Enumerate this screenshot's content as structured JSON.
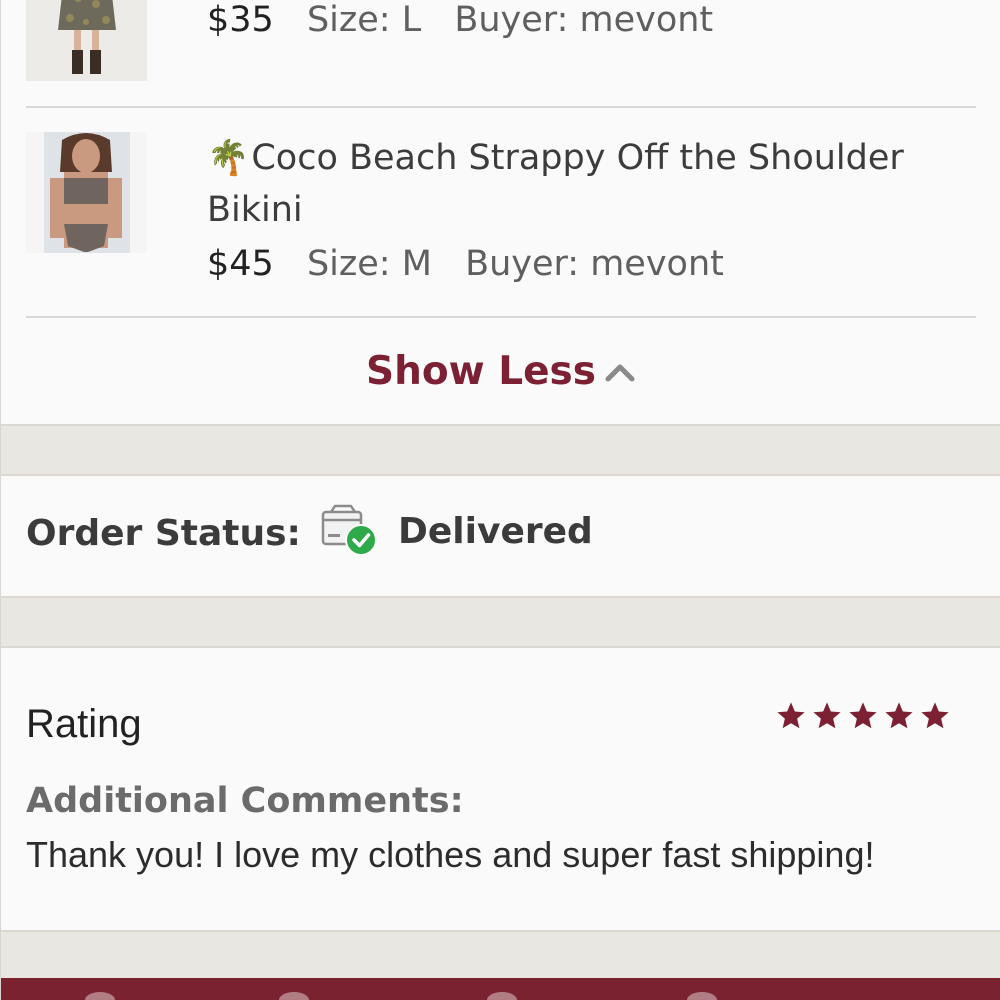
{
  "items": [
    {
      "title": "",
      "price": "$35",
      "size": "Size: L",
      "buyer": "Buyer: mevont",
      "thumb_icon": "dress-photo"
    },
    {
      "emoji": "🌴",
      "title": "Coco Beach Strappy Off the Shoulder Bikini",
      "price": "$45",
      "size": "Size: M",
      "buyer": "Buyer: mevont",
      "thumb_icon": "bikini-photo"
    }
  ],
  "show_less_label": "Show Less",
  "order_status": {
    "label": "Order Status:",
    "value": "Delivered",
    "icon": "package-delivered-icon"
  },
  "rating": {
    "label": "Rating",
    "stars": 5,
    "max_stars": 5,
    "comments_label": "Additional Comments:",
    "comments": "Thank you! I love my clothes and super fast shipping!"
  },
  "colors": {
    "accent": "#7b2133",
    "star": "#7b2133",
    "status_check": "#2faa4a",
    "band": "#e9e7e2"
  }
}
